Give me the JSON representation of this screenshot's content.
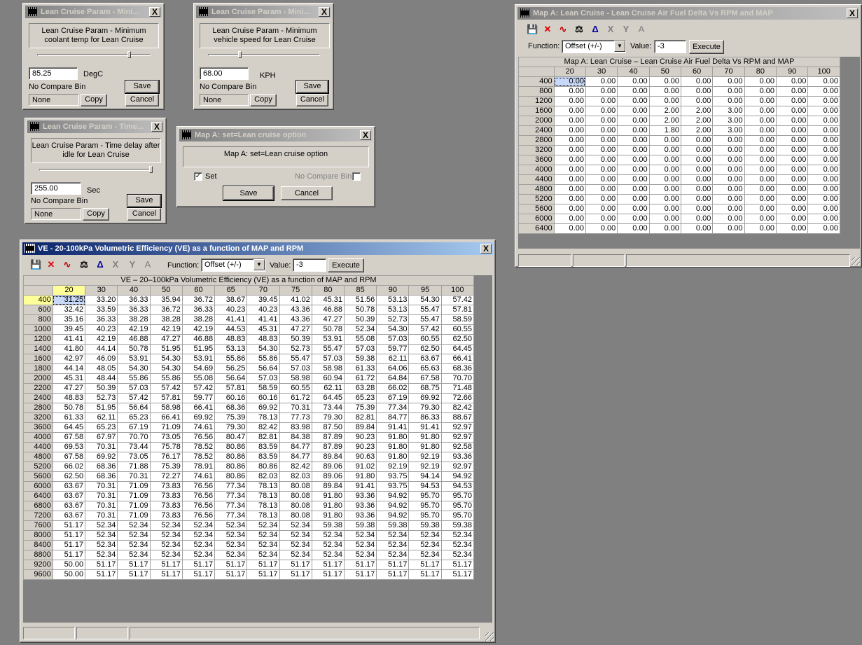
{
  "win1": {
    "title": "Lean Cruise Param - Mini...",
    "desc": "Lean Cruise Param - Minimum coolant temp for Lean Cruise",
    "value": "85.25",
    "unit": "DegC",
    "compare": "No Compare Bin",
    "compare_value": "None",
    "copy": "Copy",
    "save": "Save",
    "cancel": "Cancel",
    "slider_fraction": 0.82
  },
  "win2": {
    "title": "Lean Cruise Param - Mini...",
    "desc": "Lean Cruise Param - Minimum vehicle speed for Lean Cruise",
    "value": "68.00",
    "unit": "KPH",
    "compare": "No Compare Bin",
    "compare_value": "None",
    "copy": "Copy",
    "save": "Save",
    "cancel": "Cancel",
    "slider_fraction": 0.28
  },
  "win3": {
    "title": "Lean Cruise Param - Time...",
    "desc": "Lean Cruise Param - Time delay after idle for Lean Cruise",
    "value": "255.00",
    "unit": "Sec",
    "compare": "No Compare Bin",
    "compare_value": "None",
    "copy": "Copy",
    "save": "Save",
    "cancel": "Cancel",
    "slider_fraction": 1.0
  },
  "win4": {
    "title": "Map A: set=Lean cruise option",
    "desc": "Map A: set=Lean cruise option",
    "set_label": "Set",
    "set_checked": true,
    "compare": "No Compare Bin",
    "save": "Save",
    "cancel": "Cancel"
  },
  "ve": {
    "title": "VE - 20-100kPa Volumetric Efficiency (VE) as a function of MAP and RPM",
    "function_label": "Function:",
    "function_value": "Offset (+/-)",
    "value_label": "Value:",
    "value": "-3",
    "execute": "Execute",
    "grid_title": "VE – 20–100kPa Volumetric Efficiency (VE) as a function of MAP and RPM",
    "cols": [
      "20",
      "30",
      "40",
      "50",
      "60",
      "65",
      "70",
      "75",
      "80",
      "85",
      "90",
      "95",
      "100"
    ],
    "rows": [
      "400",
      "600",
      "800",
      "1000",
      "1200",
      "1400",
      "1600",
      "1800",
      "2000",
      "2200",
      "2400",
      "2800",
      "3200",
      "3600",
      "4000",
      "4400",
      "4800",
      "5200",
      "5600",
      "6000",
      "6400",
      "6800",
      "7200",
      "7600",
      "8000",
      "8400",
      "8800",
      "9200",
      "9600"
    ],
    "data": [
      [
        "31.25",
        "33.20",
        "36.33",
        "35.94",
        "36.72",
        "38.67",
        "39.45",
        "41.02",
        "45.31",
        "51.56",
        "53.13",
        "54.30",
        "57.42"
      ],
      [
        "32.42",
        "33.59",
        "36.33",
        "36.72",
        "36.33",
        "40.23",
        "40.23",
        "43.36",
        "46.88",
        "50.78",
        "53.13",
        "55.47",
        "57.81"
      ],
      [
        "35.16",
        "36.33",
        "38.28",
        "38.28",
        "38.28",
        "41.41",
        "41.41",
        "43.36",
        "47.27",
        "50.39",
        "52.73",
        "55.47",
        "58.59"
      ],
      [
        "39.45",
        "40.23",
        "42.19",
        "42.19",
        "42.19",
        "44.53",
        "45.31",
        "47.27",
        "50.78",
        "52.34",
        "54.30",
        "57.42",
        "60.55"
      ],
      [
        "41.41",
        "42.19",
        "46.88",
        "47.27",
        "46.88",
        "48.83",
        "48.83",
        "50.39",
        "53.91",
        "55.08",
        "57.03",
        "60.55",
        "62.50"
      ],
      [
        "41.80",
        "44.14",
        "50.78",
        "51.95",
        "51.95",
        "53.13",
        "54.30",
        "52.73",
        "55.47",
        "57.03",
        "59.77",
        "62.50",
        "64.45"
      ],
      [
        "42.97",
        "46.09",
        "53.91",
        "54.30",
        "53.91",
        "55.86",
        "55.86",
        "55.47",
        "57.03",
        "59.38",
        "62.11",
        "63.67",
        "66.41"
      ],
      [
        "44.14",
        "48.05",
        "54.30",
        "54.30",
        "54.69",
        "56.25",
        "56.64",
        "57.03",
        "58.98",
        "61.33",
        "64.06",
        "65.63",
        "68.36"
      ],
      [
        "45.31",
        "48.44",
        "55.86",
        "55.86",
        "55.08",
        "56.64",
        "57.03",
        "58.98",
        "60.94",
        "61.72",
        "64.84",
        "67.58",
        "70.70"
      ],
      [
        "47.27",
        "50.39",
        "57.03",
        "57.42",
        "57.42",
        "57.81",
        "58.59",
        "60.55",
        "62.11",
        "63.28",
        "66.02",
        "68.75",
        "71.48"
      ],
      [
        "48.83",
        "52.73",
        "57.42",
        "57.81",
        "59.77",
        "60.16",
        "60.16",
        "61.72",
        "64.45",
        "65.23",
        "67.19",
        "69.92",
        "72.66"
      ],
      [
        "50.78",
        "51.95",
        "56.64",
        "58.98",
        "66.41",
        "68.36",
        "69.92",
        "70.31",
        "73.44",
        "75.39",
        "77.34",
        "79.30",
        "82.42"
      ],
      [
        "61.33",
        "62.11",
        "65.23",
        "66.41",
        "69.92",
        "75.39",
        "78.13",
        "77.73",
        "79.30",
        "82.81",
        "84.77",
        "86.33",
        "88.67"
      ],
      [
        "64.45",
        "65.23",
        "67.19",
        "71.09",
        "74.61",
        "79.30",
        "82.42",
        "83.98",
        "87.50",
        "89.84",
        "91.41",
        "91.41",
        "92.97"
      ],
      [
        "67.58",
        "67.97",
        "70.70",
        "73.05",
        "76.56",
        "80.47",
        "82.81",
        "84.38",
        "87.89",
        "90.23",
        "91.80",
        "91.80",
        "92.97"
      ],
      [
        "69.53",
        "70.31",
        "73.44",
        "75.78",
        "78.52",
        "80.86",
        "83.59",
        "84.77",
        "87.89",
        "90.23",
        "91.80",
        "91.80",
        "92.58"
      ],
      [
        "67.58",
        "69.92",
        "73.05",
        "76.17",
        "78.52",
        "80.86",
        "83.59",
        "84.77",
        "89.84",
        "90.63",
        "91.80",
        "92.19",
        "93.36"
      ],
      [
        "66.02",
        "68.36",
        "71.88",
        "75.39",
        "78.91",
        "80.86",
        "80.86",
        "82.42",
        "89.06",
        "91.02",
        "92.19",
        "92.19",
        "92.97"
      ],
      [
        "62.50",
        "68.36",
        "70.31",
        "72.27",
        "74.61",
        "80.86",
        "82.03",
        "82.03",
        "89.06",
        "91.80",
        "93.75",
        "94.14",
        "94.92"
      ],
      [
        "63.67",
        "70.31",
        "71.09",
        "73.83",
        "76.56",
        "77.34",
        "78.13",
        "80.08",
        "89.84",
        "91.41",
        "93.75",
        "94.53",
        "94.53"
      ],
      [
        "63.67",
        "70.31",
        "71.09",
        "73.83",
        "76.56",
        "77.34",
        "78.13",
        "80.08",
        "91.80",
        "93.36",
        "94.92",
        "95.70",
        "95.70"
      ],
      [
        "63.67",
        "70.31",
        "71.09",
        "73.83",
        "76.56",
        "77.34",
        "78.13",
        "80.08",
        "91.80",
        "93.36",
        "94.92",
        "95.70",
        "95.70"
      ],
      [
        "63.67",
        "70.31",
        "71.09",
        "73.83",
        "76.56",
        "77.34",
        "78.13",
        "80.08",
        "91.80",
        "93.36",
        "94.92",
        "95.70",
        "95.70"
      ],
      [
        "51.17",
        "52.34",
        "52.34",
        "52.34",
        "52.34",
        "52.34",
        "52.34",
        "52.34",
        "59.38",
        "59.38",
        "59.38",
        "59.38",
        "59.38"
      ],
      [
        "51.17",
        "52.34",
        "52.34",
        "52.34",
        "52.34",
        "52.34",
        "52.34",
        "52.34",
        "52.34",
        "52.34",
        "52.34",
        "52.34",
        "52.34"
      ],
      [
        "51.17",
        "52.34",
        "52.34",
        "52.34",
        "52.34",
        "52.34",
        "52.34",
        "52.34",
        "52.34",
        "52.34",
        "52.34",
        "52.34",
        "52.34"
      ],
      [
        "51.17",
        "52.34",
        "52.34",
        "52.34",
        "52.34",
        "52.34",
        "52.34",
        "52.34",
        "52.34",
        "52.34",
        "52.34",
        "52.34",
        "52.34"
      ],
      [
        "50.00",
        "51.17",
        "51.17",
        "51.17",
        "51.17",
        "51.17",
        "51.17",
        "51.17",
        "51.17",
        "51.17",
        "51.17",
        "51.17",
        "51.17"
      ],
      [
        "50.00",
        "51.17",
        "51.17",
        "51.17",
        "51.17",
        "51.17",
        "51.17",
        "51.17",
        "51.17",
        "51.17",
        "51.17",
        "51.17",
        "51.17"
      ]
    ]
  },
  "afr": {
    "title": "Map A: Lean Cruise - Lean Cruise Air Fuel Delta Vs RPM and MAP",
    "function_label": "Function:",
    "function_value": "Offset (+/-)",
    "value_label": "Value:",
    "value": "-3",
    "execute": "Execute",
    "grid_title": "Map A: Lean Cruise – Lean Cruise Air Fuel Delta Vs RPM and MAP",
    "cols": [
      "20",
      "30",
      "40",
      "50",
      "60",
      "70",
      "80",
      "90",
      "100"
    ],
    "rows": [
      "400",
      "800",
      "1200",
      "1600",
      "2000",
      "2400",
      "2800",
      "3200",
      "3600",
      "4000",
      "4400",
      "4800",
      "5200",
      "5600",
      "6000",
      "6400"
    ],
    "data": [
      [
        "0.00",
        "0.00",
        "0.00",
        "0.00",
        "0.00",
        "0.00",
        "0.00",
        "0.00",
        "0.00"
      ],
      [
        "0.00",
        "0.00",
        "0.00",
        "0.00",
        "0.00",
        "0.00",
        "0.00",
        "0.00",
        "0.00"
      ],
      [
        "0.00",
        "0.00",
        "0.00",
        "0.00",
        "0.00",
        "0.00",
        "0.00",
        "0.00",
        "0.00"
      ],
      [
        "0.00",
        "0.00",
        "0.00",
        "2.00",
        "2.00",
        "3.00",
        "0.00",
        "0.00",
        "0.00"
      ],
      [
        "0.00",
        "0.00",
        "0.00",
        "2.00",
        "2.00",
        "3.00",
        "0.00",
        "0.00",
        "0.00"
      ],
      [
        "0.00",
        "0.00",
        "0.00",
        "1.80",
        "2.00",
        "3.00",
        "0.00",
        "0.00",
        "0.00"
      ],
      [
        "0.00",
        "0.00",
        "0.00",
        "0.00",
        "0.00",
        "0.00",
        "0.00",
        "0.00",
        "0.00"
      ],
      [
        "0.00",
        "0.00",
        "0.00",
        "0.00",
        "0.00",
        "0.00",
        "0.00",
        "0.00",
        "0.00"
      ],
      [
        "0.00",
        "0.00",
        "0.00",
        "0.00",
        "0.00",
        "0.00",
        "0.00",
        "0.00",
        "0.00"
      ],
      [
        "0.00",
        "0.00",
        "0.00",
        "0.00",
        "0.00",
        "0.00",
        "0.00",
        "0.00",
        "0.00"
      ],
      [
        "0.00",
        "0.00",
        "0.00",
        "0.00",
        "0.00",
        "0.00",
        "0.00",
        "0.00",
        "0.00"
      ],
      [
        "0.00",
        "0.00",
        "0.00",
        "0.00",
        "0.00",
        "0.00",
        "0.00",
        "0.00",
        "0.00"
      ],
      [
        "0.00",
        "0.00",
        "0.00",
        "0.00",
        "0.00",
        "0.00",
        "0.00",
        "0.00",
        "0.00"
      ],
      [
        "0.00",
        "0.00",
        "0.00",
        "0.00",
        "0.00",
        "0.00",
        "0.00",
        "0.00",
        "0.00"
      ],
      [
        "0.00",
        "0.00",
        "0.00",
        "0.00",
        "0.00",
        "0.00",
        "0.00",
        "0.00",
        "0.00"
      ],
      [
        "0.00",
        "0.00",
        "0.00",
        "0.00",
        "0.00",
        "0.00",
        "0.00",
        "0.00",
        "0.00"
      ]
    ]
  },
  "toolbar_icons": [
    "save-icon",
    "delete-icon",
    "graph-icon",
    "scale-icon",
    "triangle-a-icon",
    "cut-x-icon",
    "split-icon",
    "font-a-icon"
  ],
  "close_glyph": "X",
  "dropdown_glyph": "▼",
  "check_glyph": "✓"
}
